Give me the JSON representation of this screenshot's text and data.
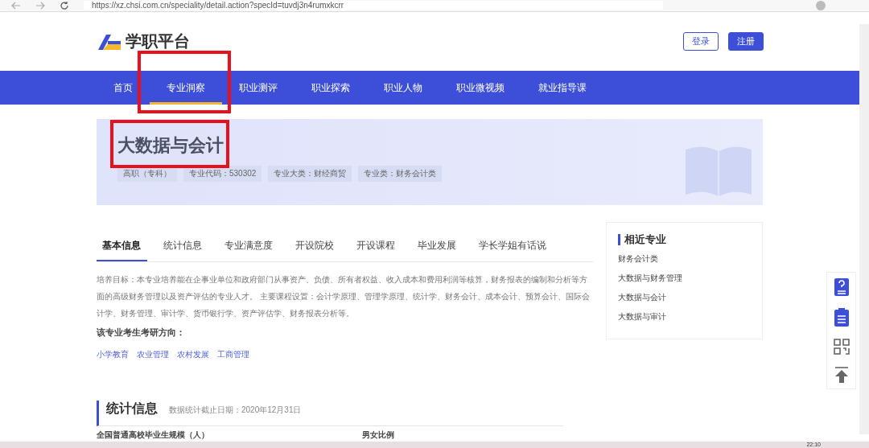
{
  "browser": {
    "url": "https://xz.chsi.com.cn/speciality/detail.action?specId=tuvdj3n4rumxkcrr"
  },
  "header": {
    "logo_text": "学职平台",
    "login": "登录",
    "register": "注册"
  },
  "nav": [
    {
      "label": "首页",
      "selected": false
    },
    {
      "label": "专业洞察",
      "selected": true
    },
    {
      "label": "职业测评",
      "selected": false
    },
    {
      "label": "职业探索",
      "selected": false
    },
    {
      "label": "职业人物",
      "selected": false
    },
    {
      "label": "职业微视频",
      "selected": false
    },
    {
      "label": "就业指导课",
      "selected": false
    }
  ],
  "banner": {
    "title": "大数据与会计",
    "tags": [
      "高职（专科）",
      "专业代码：530302",
      "专业大类：财经商贸",
      "专业类：财务会计类"
    ]
  },
  "tabs": [
    {
      "label": "基本信息",
      "selected": true
    },
    {
      "label": "统计信息",
      "selected": false
    },
    {
      "label": "专业满意度",
      "selected": false
    },
    {
      "label": "开设院校",
      "selected": false
    },
    {
      "label": "开设课程",
      "selected": false
    },
    {
      "label": "毕业发展",
      "selected": false
    },
    {
      "label": "学长学姐有话说",
      "selected": false
    }
  ],
  "description": "培养目标：本专业培养能在企事业单位和政府部门从事资产、负债、所有者权益、收入成本和费用利润等核算，财务报表的编制和分析等方面的高级财务管理以及资产评估的专业人才。 主要课程设置：会计学原理、管理学原理、统计学、财务会计、成本会计、预算会计、国际会计学、财务管理、审计学、货币银行学、资产评估学、财务报表分析等。",
  "postgrad": {
    "heading": "该专业考生考研方向：",
    "links": [
      "小学教育",
      "农业管理",
      "农村发展",
      "工商管理"
    ]
  },
  "related": {
    "title": "相近专业",
    "items": [
      "财务会计类",
      "大数据与财务管理",
      "大数据与会计",
      "大数据与审计"
    ]
  },
  "stats": {
    "title": "统计信息",
    "note": "数据统计截止日期：2020年12月31日",
    "sub_1": "全国普通高校毕业生规模（人）",
    "sub_2": "男女比例"
  },
  "taskbar": {
    "time": "22:10"
  }
}
